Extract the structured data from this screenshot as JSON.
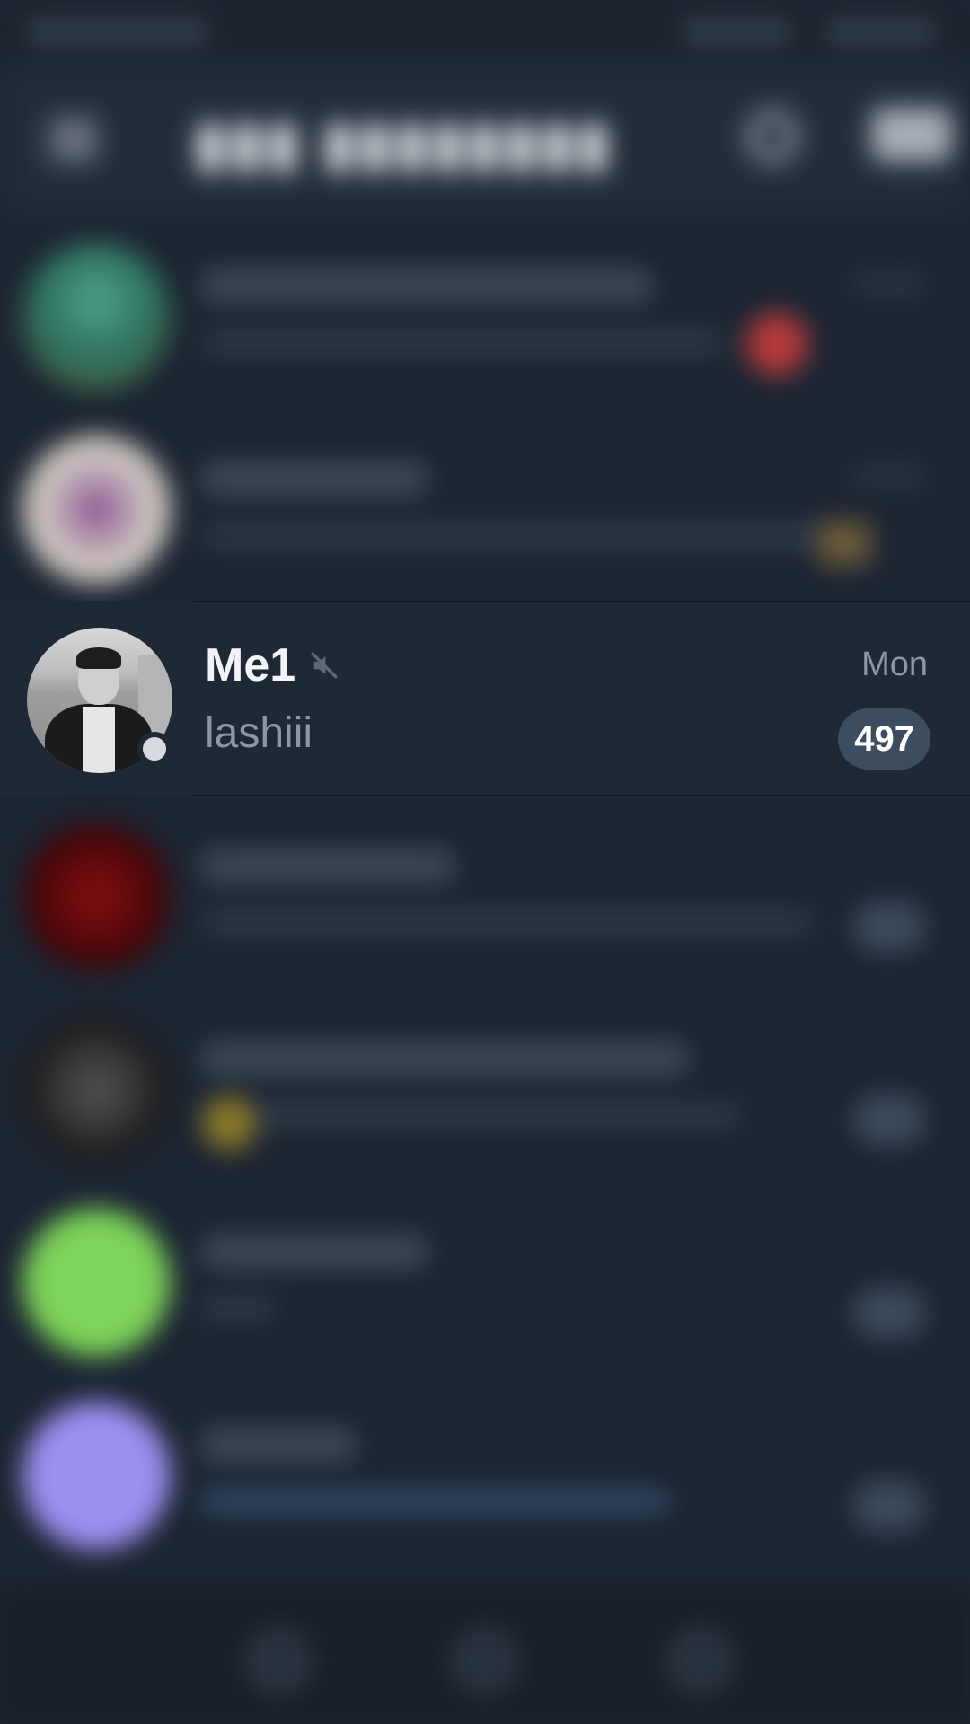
{
  "focused_chat": {
    "name": "Me1",
    "time": "Mon",
    "preview": "lashiii",
    "unread_count": "497",
    "muted": true,
    "online_status": "online"
  },
  "background": {
    "blurred": true,
    "colors": {
      "background": "#1d2633",
      "header": "#222c3a",
      "badge": "#3d4d60",
      "secondary_text": "#8b97a6"
    },
    "avatar_colors": [
      "#3a8a72",
      "#b9a6b3",
      "#7a0f12",
      "#3b3b3b",
      "#7ed35a",
      "#9b8ff0"
    ]
  }
}
